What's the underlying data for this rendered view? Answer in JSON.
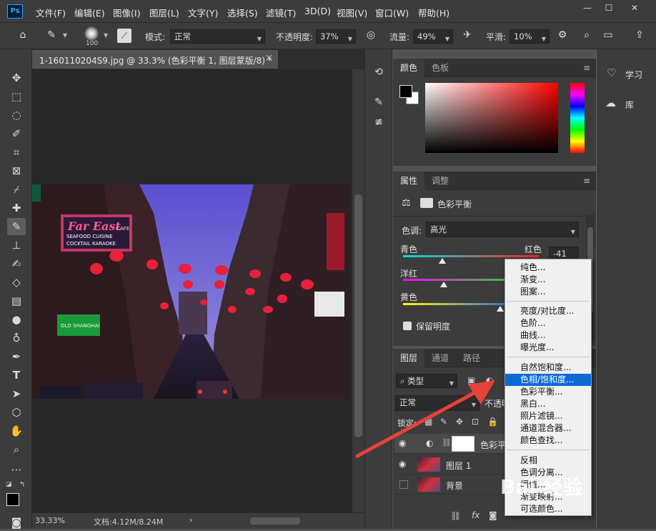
{
  "menubar": {
    "logo": "Ps",
    "items": [
      "文件(F)",
      "编辑(E)",
      "图像(I)",
      "图层(L)",
      "文字(Y)",
      "选择(S)",
      "滤镜(T)",
      "3D(D)",
      "视图(V)",
      "窗口(W)",
      "帮助(H)"
    ],
    "minimize": "—",
    "restore": "☐",
    "close": "✕"
  },
  "options": {
    "brush_size": "100",
    "mode_label": "模式:",
    "mode_value": "正常",
    "opacity_label": "不透明度:",
    "opacity_value": "37%",
    "flow_label": "流量:",
    "flow_value": "49%",
    "smooth_label": "平滑:",
    "smooth_value": "10%"
  },
  "document": {
    "tab_title": "1-160110204S9.jpg @ 33.3% (色彩平衡 1, 图层蒙版/8) *",
    "tab_close": "×",
    "zoom": "33.33%",
    "doc_info": "文档:4.12M/8.24M",
    "status_arrow": "›",
    "sign_left": "Far East",
    "sign_cafe": "CAFE",
    "sign_line1": "SEAFOOD CUISINE",
    "sign_line2": "COCKTAIL KARAOKE",
    "sign_green": "OLD SHANGHAI"
  },
  "color_panel": {
    "tabs": [
      "颜色",
      "色板"
    ]
  },
  "properties_panel": {
    "tabs": [
      "属性",
      "调整"
    ],
    "title": "色彩平衡",
    "tone_label": "色调:",
    "tone_value": "高光",
    "slider1_left": "青色",
    "slider1_right": "红色",
    "slider1_value": "-41",
    "slider2_left": "洋红",
    "slider3_left": "黄色",
    "preserve_label": "保留明度"
  },
  "layers_panel": {
    "tabs": [
      "图层",
      "通道",
      "路径"
    ],
    "filter_value": "类型",
    "blend_mode": "正常",
    "opacity_label": "不透明",
    "lock_label": "锁定:",
    "layers": [
      {
        "name": "色彩平"
      },
      {
        "name": "图层 1"
      },
      {
        "name": "背景"
      }
    ],
    "fx": "fx"
  },
  "learn_panel": {
    "learn": "学习",
    "library": "库"
  },
  "context_menu": {
    "groups": [
      [
        "纯色...",
        "渐变...",
        "图案..."
      ],
      [
        "亮度/对比度...",
        "色阶...",
        "曲线...",
        "曝光度..."
      ],
      [
        "自然饱和度...",
        "色相/饱和度...",
        "色彩平衡...",
        "黑白...",
        "照片滤镜...",
        "通道混合器...",
        "颜色查找..."
      ],
      [
        "反相",
        "色调分离...",
        "阈值...",
        "渐变映射...",
        "可选颜色..."
      ]
    ],
    "selected": "色相/饱和度..."
  },
  "watermark": "Bai 经验"
}
